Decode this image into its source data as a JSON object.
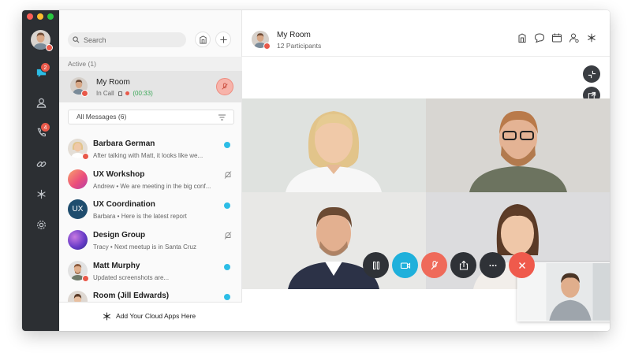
{
  "search": {
    "placeholder": "Search"
  },
  "rail": {
    "chat_badge": "2",
    "calls_badge": "4"
  },
  "active": {
    "header": "Active (1)",
    "room_name": "My Room",
    "status_prefix": "In Call",
    "duration": "(00:33)"
  },
  "filter": {
    "label": "All Messages (6)"
  },
  "conversations": [
    {
      "name": "Barbara German",
      "preview": "After talking with Matt, it looks like we...",
      "indicator": "unread"
    },
    {
      "name": "UX Workshop",
      "preview": "Andrew • We are meeting in the big conf...",
      "indicator": "muted"
    },
    {
      "name": "UX Coordination",
      "preview": "Barbara • Here is the latest report",
      "indicator": "unread",
      "avatar_text": "UX"
    },
    {
      "name": "Design Group",
      "preview": "Tracy • Next meetup is in Santa Cruz",
      "indicator": "muted"
    },
    {
      "name": "Matt Murphy",
      "preview": "Updated screenshots are...",
      "indicator": "unread"
    },
    {
      "name": "Room (Jill Edwards)",
      "preview": "",
      "indicator": "unread"
    }
  ],
  "cloud_apps": {
    "label": "Add Your Cloud Apps Here"
  },
  "room": {
    "title": "My Room",
    "participants": "12 Participants"
  },
  "colors": {
    "rail_bg": "#2c2f33",
    "accent_blue": "#2cbde6",
    "alert_red": "#e8594a",
    "call_green": "#3aa757"
  }
}
